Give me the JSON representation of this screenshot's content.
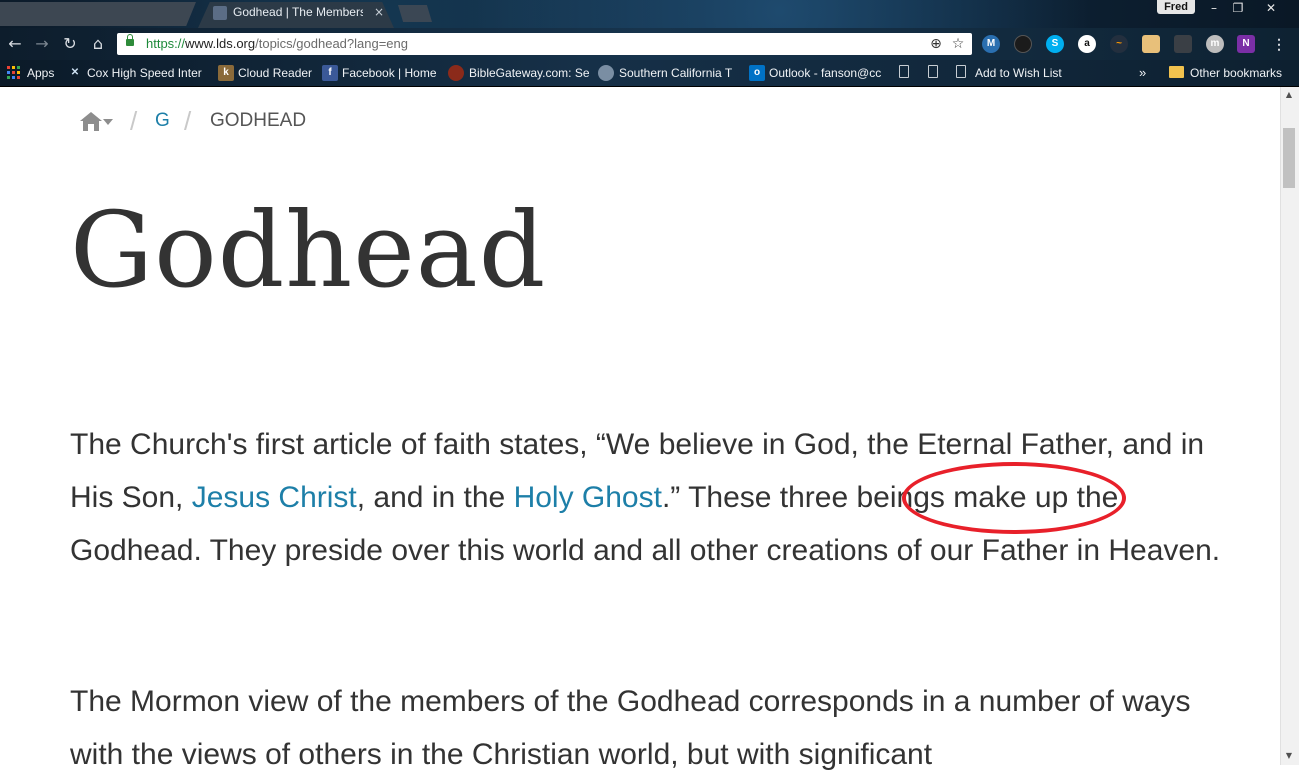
{
  "browser": {
    "active_tab_title": "Godhead | The Members",
    "user_name": "Fred",
    "url": {
      "scheme": "https://",
      "host": "www.lds.org",
      "path": "/topics/godhead?lang=eng"
    },
    "bookmarks": [
      {
        "label": "Apps"
      },
      {
        "label": "Cox High Speed Inter"
      },
      {
        "label": "Cloud Reader"
      },
      {
        "label": "Facebook | Home"
      },
      {
        "label": "BibleGateway.com: Se"
      },
      {
        "label": "Southern California T"
      },
      {
        "label": "Outlook - fanson@cc"
      },
      {
        "label": "Add to Wish List"
      }
    ],
    "overflow_label": "»",
    "other_bookmarks": "Other bookmarks"
  },
  "breadcrumb": {
    "letter": "G",
    "current": "GODHEAD"
  },
  "page": {
    "title": "Godhead",
    "paragraph1": {
      "part1": "The Church's first article of faith states, “We believe in God, the Eternal Father, and in His Son, ",
      "link1": "Jesus Christ",
      "part2": ", and in the ",
      "link2": "Holy Ghost",
      "part3": ".” These three beings make up the Godhead. They preside over this world and all other creations of our Father in Heaven."
    },
    "paragraph2": "The Mormon view of the members of the Godhead corresponds in a number of ways with the views of others in the Christian world, but with significant"
  },
  "annotation": {
    "type": "red-ellipse",
    "target_text": "three beings",
    "color": "#e8202a"
  }
}
